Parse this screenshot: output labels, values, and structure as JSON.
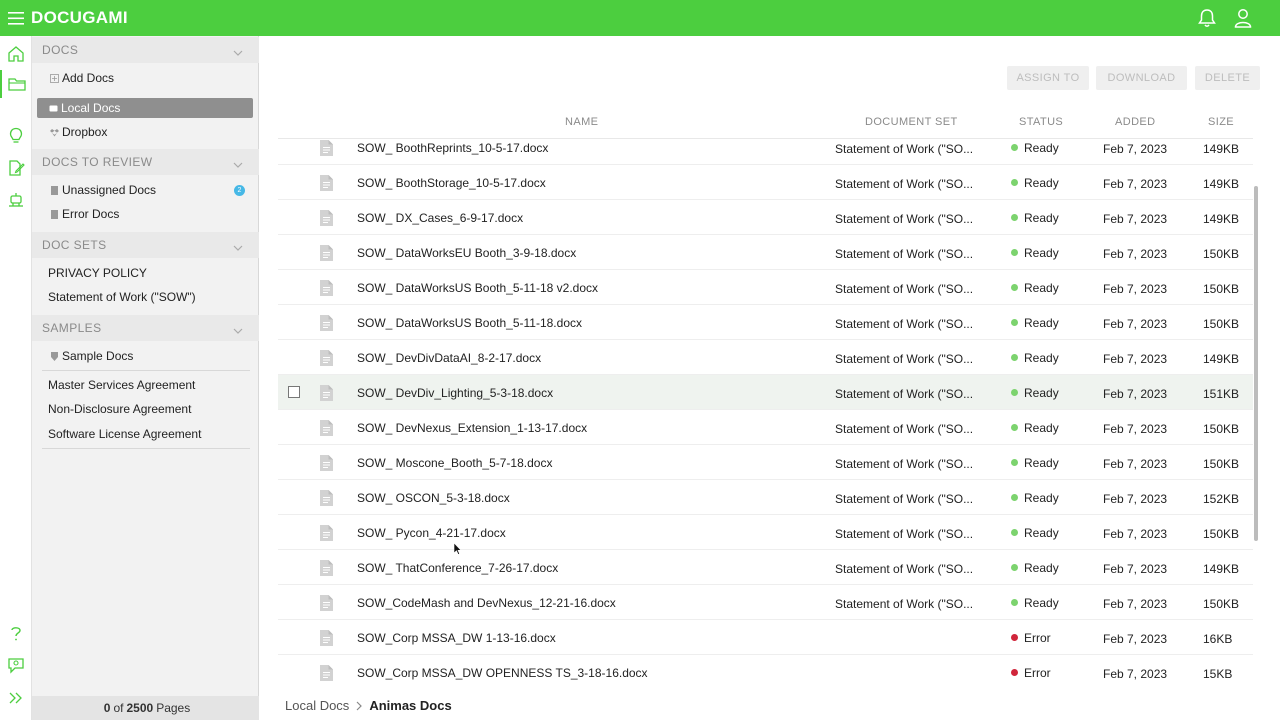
{
  "app": {
    "title": "DOCUGAMI"
  },
  "colors": {
    "brand": "#4cce3f",
    "ready": "#7cd36e",
    "error": "#d0253b",
    "badge": "#46b8e6"
  },
  "topbar": {
    "icons": [
      "menu-icon",
      "bell-icon",
      "user-icon"
    ]
  },
  "rail": {
    "icons": [
      "home-icon",
      "folder-icon",
      "lightbulb-icon",
      "edit-doc-icon",
      "robot-icon",
      "help-icon",
      "feedback-icon",
      "expand-icon"
    ]
  },
  "sidebar": {
    "docs": {
      "header": "DOCS",
      "add": "Add Docs",
      "local": "Local Docs",
      "dropbox": "Dropbox"
    },
    "review": {
      "header": "DOCS TO REVIEW",
      "unassigned": "Unassigned Docs",
      "unassigned_count": "2",
      "error": "Error Docs"
    },
    "docsets": {
      "header": "DOC SETS",
      "items": [
        "PRIVACY POLICY",
        "Statement of Work (\"SOW\")"
      ]
    },
    "samples": {
      "header": "SAMPLES",
      "sample_docs": "Sample Docs",
      "items": [
        "Master Services Agreement",
        "Non-Disclosure Agreement",
        "Software License Agreement"
      ]
    },
    "pager": {
      "count": "0",
      "of": "of",
      "total": "2500",
      "unit": "Pages"
    }
  },
  "toolbar": {
    "assign": "ASSIGN TO",
    "download": "DOWNLOAD",
    "delete": "DELETE"
  },
  "table": {
    "columns": {
      "name": "NAME",
      "docset": "DOCUMENT SET",
      "status": "STATUS",
      "added": "ADDED",
      "size": "SIZE"
    },
    "rows": [
      {
        "name": "SOW_ BoothReprints_10-5-17.docx",
        "docset": "Statement of Work (\"SO...",
        "status": "Ready",
        "added": "Feb 7, 2023",
        "size": "149KB"
      },
      {
        "name": "SOW_ BoothStorage_10-5-17.docx",
        "docset": "Statement of Work (\"SO...",
        "status": "Ready",
        "added": "Feb 7, 2023",
        "size": "149KB"
      },
      {
        "name": "SOW_ DX_Cases_6-9-17.docx",
        "docset": "Statement of Work (\"SO...",
        "status": "Ready",
        "added": "Feb 7, 2023",
        "size": "149KB"
      },
      {
        "name": "SOW_ DataWorksEU Booth_3-9-18.docx",
        "docset": "Statement of Work (\"SO...",
        "status": "Ready",
        "added": "Feb 7, 2023",
        "size": "150KB"
      },
      {
        "name": "SOW_ DataWorksUS Booth_5-11-18 v2.docx",
        "docset": "Statement of Work (\"SO...",
        "status": "Ready",
        "added": "Feb 7, 2023",
        "size": "150KB"
      },
      {
        "name": "SOW_ DataWorksUS Booth_5-11-18.docx",
        "docset": "Statement of Work (\"SO...",
        "status": "Ready",
        "added": "Feb 7, 2023",
        "size": "150KB"
      },
      {
        "name": "SOW_ DevDivDataAI_8-2-17.docx",
        "docset": "Statement of Work (\"SO...",
        "status": "Ready",
        "added": "Feb 7, 2023",
        "size": "149KB"
      },
      {
        "name": "SOW_ DevDiv_Lighting_5-3-18.docx",
        "docset": "Statement of Work (\"SO...",
        "status": "Ready",
        "added": "Feb 7, 2023",
        "size": "151KB"
      },
      {
        "name": "SOW_ DevNexus_Extension_1-13-17.docx",
        "docset": "Statement of Work (\"SO...",
        "status": "Ready",
        "added": "Feb 7, 2023",
        "size": "150KB"
      },
      {
        "name": "SOW_ Moscone_Booth_5-7-18.docx",
        "docset": "Statement of Work (\"SO...",
        "status": "Ready",
        "added": "Feb 7, 2023",
        "size": "150KB"
      },
      {
        "name": "SOW_ OSCON_5-3-18.docx",
        "docset": "Statement of Work (\"SO...",
        "status": "Ready",
        "added": "Feb 7, 2023",
        "size": "152KB"
      },
      {
        "name": "SOW_ Pycon_4-21-17.docx",
        "docset": "Statement of Work (\"SO...",
        "status": "Ready",
        "added": "Feb 7, 2023",
        "size": "150KB"
      },
      {
        "name": "SOW_ ThatConference_7-26-17.docx",
        "docset": "Statement of Work (\"SO...",
        "status": "Ready",
        "added": "Feb 7, 2023",
        "size": "149KB"
      },
      {
        "name": "SOW_CodeMash and DevNexus_12-21-16.docx",
        "docset": "Statement of Work (\"SO...",
        "status": "Ready",
        "added": "Feb 7, 2023",
        "size": "150KB"
      },
      {
        "name": "SOW_Corp MSSA_DW 1-13-16.docx",
        "docset": "",
        "status": "Error",
        "added": "Feb 7, 2023",
        "size": "16KB"
      },
      {
        "name": "SOW_Corp MSSA_DW OPENNESS TS_3-18-16.docx",
        "docset": "",
        "status": "Error",
        "added": "Feb 7, 2023",
        "size": "15KB"
      }
    ]
  },
  "breadcrumb": {
    "parent": "Local Docs",
    "current": "Animas Docs"
  }
}
